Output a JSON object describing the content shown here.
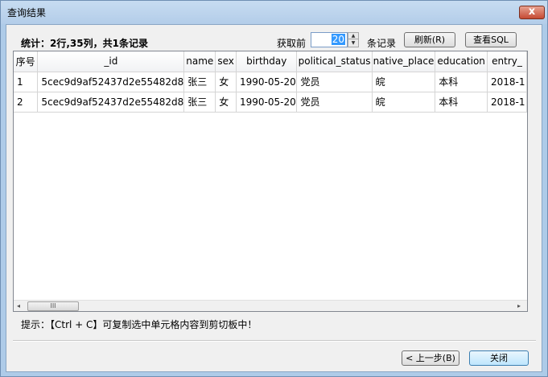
{
  "window": {
    "title": "查询结果",
    "close_glyph": "x"
  },
  "toolbar": {
    "stats": "统计：2行,35列，共1条记录",
    "fetch_label": "获取前",
    "fetch_value": "20",
    "records_label": "条记录",
    "refresh_label": "刷新(R)",
    "view_sql_label": "查看SQL"
  },
  "table": {
    "columns": [
      "序号",
      "_id",
      "name",
      "sex",
      "birthday",
      "political_status",
      "native_place",
      "education",
      "entry_"
    ],
    "rows": [
      [
        "1",
        "5cec9d9af52437d2e55482d8",
        "张三",
        "女",
        "1990-05-20",
        "党员",
        "皖",
        "本科",
        "2018-1"
      ],
      [
        "2",
        "5cec9d9af52437d2e55482d8",
        "张三",
        "女",
        "1990-05-20",
        "党员",
        "皖",
        "本科",
        "2018-1"
      ]
    ]
  },
  "scrollbar": {
    "left_arrow": "◂",
    "right_arrow": "▸",
    "thumb_grip": "III"
  },
  "hint": "提示：【Ctrl + C】可复制选中单元格内容到剪切板中！",
  "footer": {
    "prev_label": "< 上一步(B)",
    "close_label": "关闭"
  }
}
